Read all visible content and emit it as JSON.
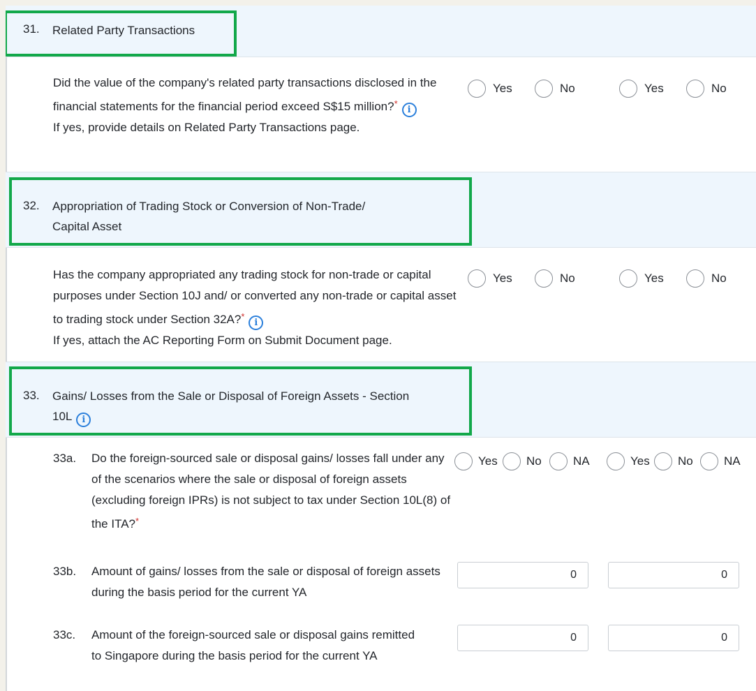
{
  "sections": [
    {
      "number": "31.",
      "title": "Related Party Transactions",
      "question": "Did the value of the company's related party transactions disclosed in the financial statements for the financial period exceed S$15 million?",
      "note": "If yes, provide details on Related Party Transactions page."
    },
    {
      "number": "32.",
      "title_line1": "Appropriation of Trading Stock or Conversion of Non-Trade/",
      "title_line2": "Capital Asset",
      "question": "Has the company appropriated any trading stock for non-trade or capital purposes under Section 10J and/ or converted any non-trade or capital asset to trading stock under Section 32A?",
      "note": "If yes, attach the AC Reporting Form on Submit Document page."
    },
    {
      "number": "33.",
      "title_line1": "Gains/ Losses from the Sale or Disposal of Foreign Assets - Section",
      "title_line2": "10L",
      "sub": [
        {
          "number": "33a.",
          "text": "Do the foreign-sourced sale or disposal gains/ losses fall under any of the scenarios where the sale or disposal of foreign assets (excluding foreign IPRs) is not subject to tax under Section 10L(8) of the ITA?"
        },
        {
          "number": "33b.",
          "text": "Amount of gains/ losses from the sale or disposal of foreign assets during the basis period for the current YA",
          "value1": "0",
          "value2": "0"
        },
        {
          "number": "33c.",
          "text": "Amount of the foreign-sourced sale or disposal gains remitted to Singapore during the basis period for the current YA",
          "value1": "0",
          "value2": "0"
        }
      ]
    }
  ],
  "labels": {
    "yes": "Yes",
    "no": "No",
    "na": "NA",
    "required_mark": "*",
    "info_glyph": "i"
  },
  "colors": {
    "highlight": "#12a84a",
    "section_bg": "#eef6fd",
    "required": "#d0312d",
    "info": "#2a7fdb"
  }
}
